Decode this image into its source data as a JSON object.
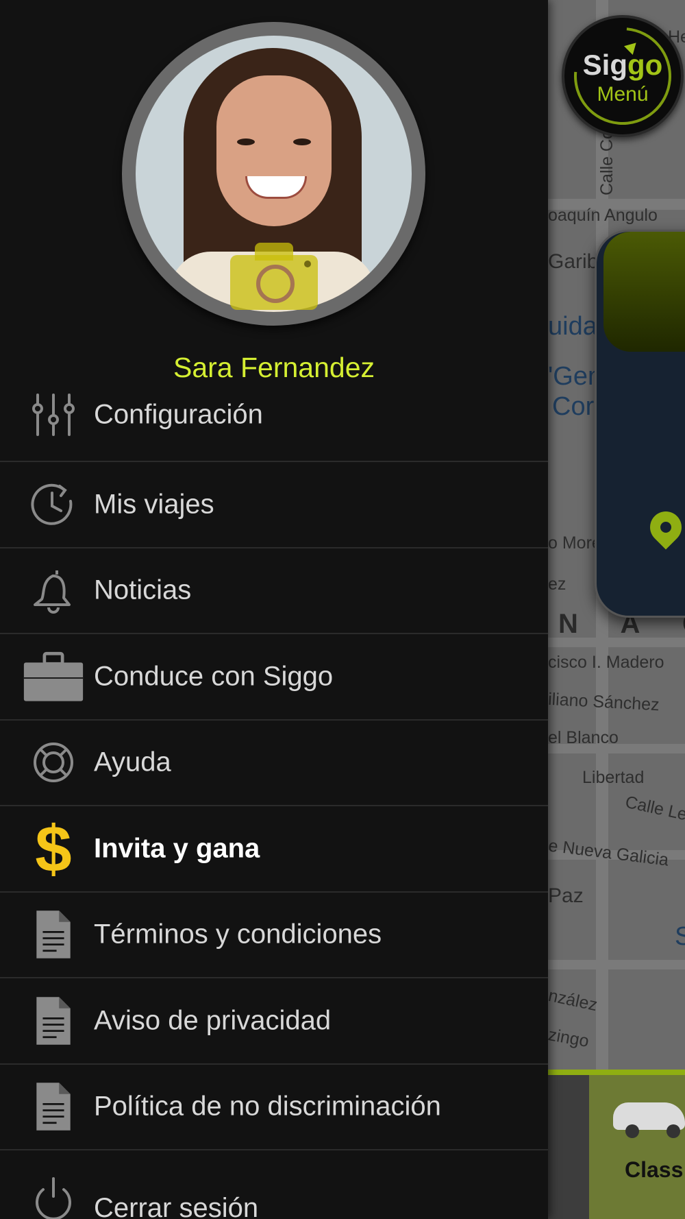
{
  "map": {
    "street_labels": [
      "Calle Co",
      "oaquín Angulo",
      "Garib",
      "uida",
      "o Moreno",
      "ez",
      "cisco I. Madero",
      "iliano Sánchez",
      "el Blanco",
      "Libertad",
      "Calle Le",
      "e Nueva Galicia",
      "Paz",
      "nzález",
      "zingo",
      "He"
    ],
    "place_labels": [
      "'General",
      "Corona\""
    ],
    "area_label": "N A C",
    "trailing_letter": "S"
  },
  "siggo_badge": {
    "brand_part1": "Sig",
    "brand_part2": "go",
    "subtitle": "Menú"
  },
  "vehicle_strip": {
    "label": "Class"
  },
  "drawer": {
    "user_name": "Sara Fernandez",
    "menu": [
      {
        "label": "Configuración",
        "icon": "sliders-icon"
      },
      {
        "label": "Mis viajes",
        "icon": "history-icon"
      },
      {
        "label": "Noticias",
        "icon": "bell-icon"
      },
      {
        "label": "Conduce con Siggo",
        "icon": "briefcase-icon"
      },
      {
        "label": "Ayuda",
        "icon": "lifebuoy-icon"
      },
      {
        "label": "Invita y gana",
        "icon": "dollar-icon"
      },
      {
        "label": "Términos y condiciones",
        "icon": "document-icon"
      },
      {
        "label": "Aviso de privacidad",
        "icon": "document-icon"
      },
      {
        "label": "Política de no discriminación",
        "icon": "document-icon"
      },
      {
        "label": "Cerrar sesión",
        "icon": "power-icon"
      }
    ]
  },
  "colors": {
    "accent": "#d5ef32",
    "dollar": "#f5c518",
    "drawer_bg": "#121212",
    "divider": "#2b2b2b"
  }
}
